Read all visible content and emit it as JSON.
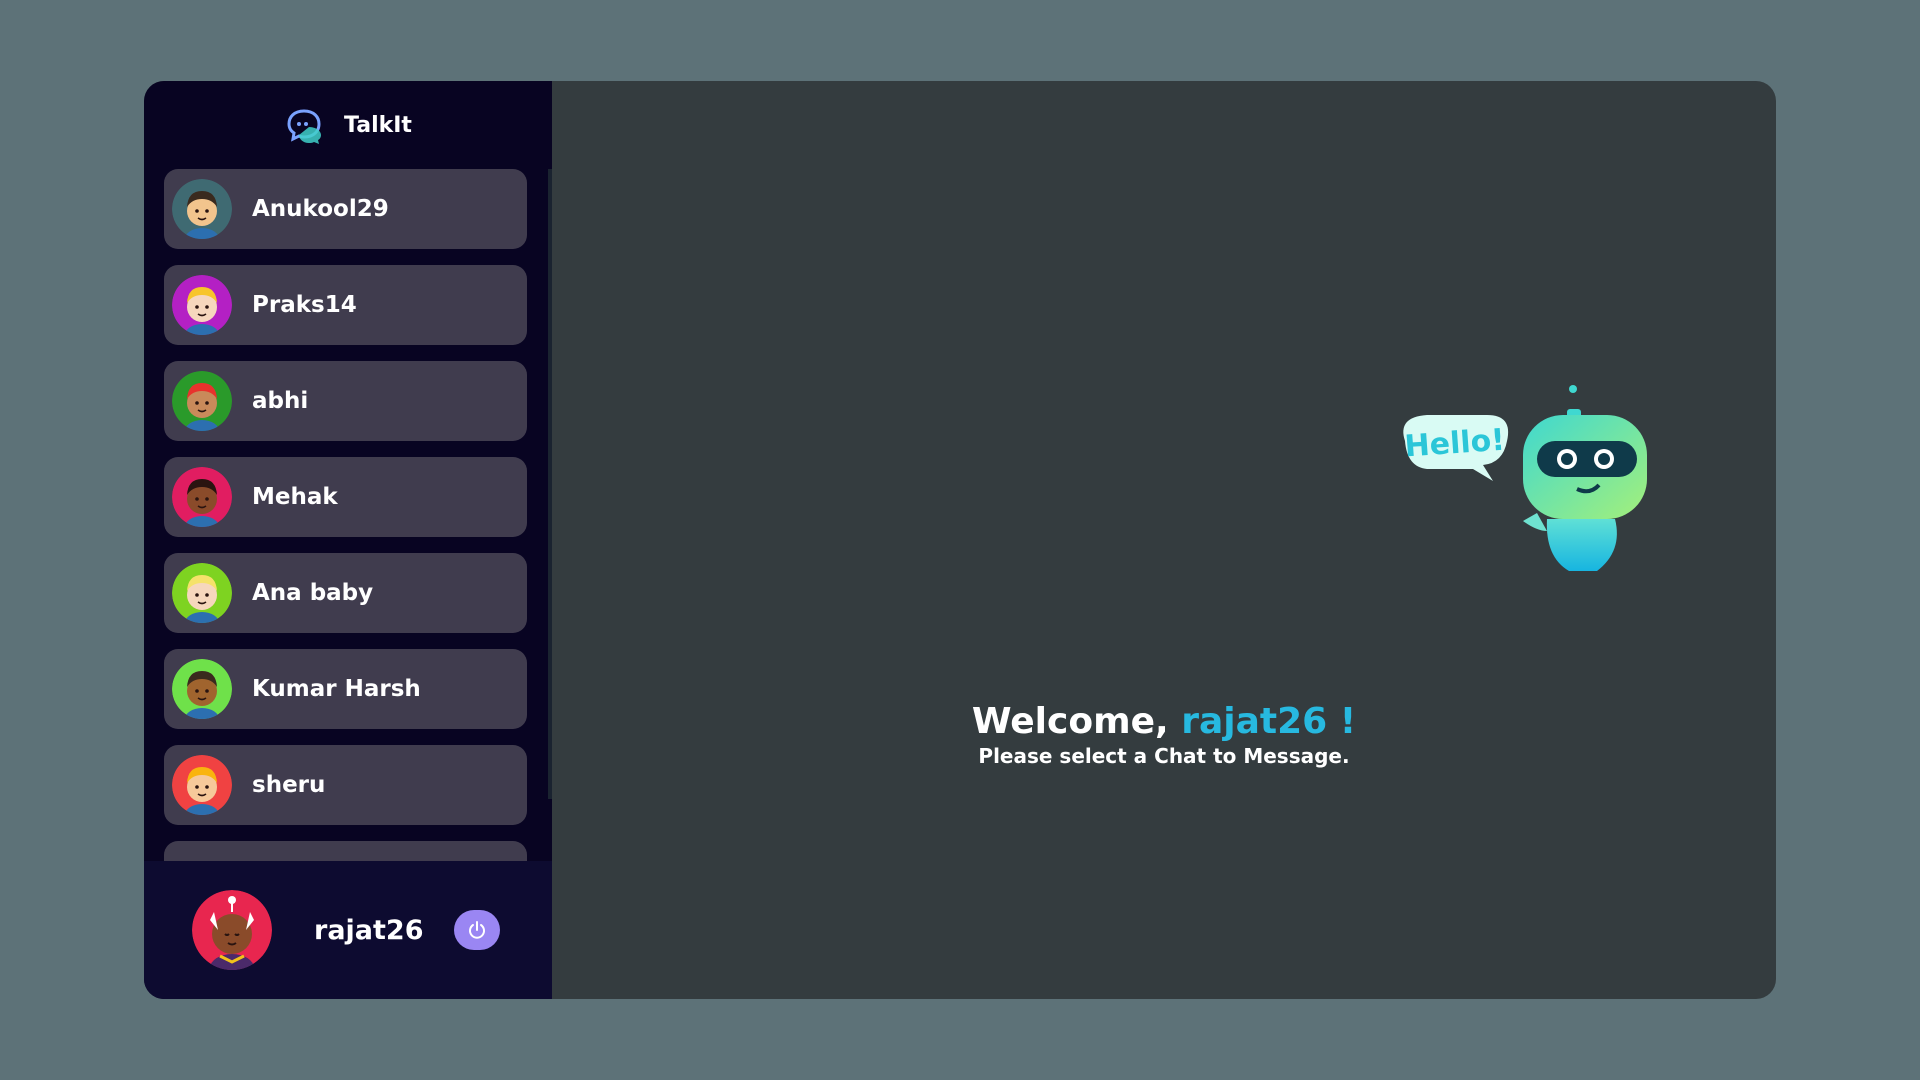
{
  "app": {
    "name": "TalkIt"
  },
  "contacts": [
    {
      "name": "Anukool29",
      "avatar_bg": "#3f6a72",
      "skin": "#f2c48d",
      "hair": "#3a2a1e"
    },
    {
      "name": "Praks14",
      "avatar_bg": "#b420c4",
      "skin": "#f6d7bd",
      "hair": "#f7c52a"
    },
    {
      "name": "abhi",
      "avatar_bg": "#2a9a2a",
      "skin": "#c98a5a",
      "hair": "#e8322c"
    },
    {
      "name": "Mehak",
      "avatar_bg": "#e11d61",
      "skin": "#8a4b2a",
      "hair": "#2a1410"
    },
    {
      "name": "Ana baby",
      "avatar_bg": "#7ed321",
      "skin": "#f6d7bd",
      "hair": "#f5e26a"
    },
    {
      "name": "Kumar Harsh",
      "avatar_bg": "#6fe14a",
      "skin": "#a0642e",
      "hair": "#3a2a1e"
    },
    {
      "name": "sheru",
      "avatar_bg": "#f04242",
      "skin": "#f6c99a",
      "hair": "#f9b40e"
    }
  ],
  "current_user": {
    "name": "rajat26",
    "avatar_bg": "#e8264f",
    "skin": "#8a4b2a"
  },
  "welcome": {
    "prefix": "Welcome, ",
    "username": "rajat26 !",
    "subtitle": "Please select a Chat to Message."
  },
  "robot": {
    "bubble_text": "Hello!"
  },
  "colors": {
    "page_bg": "#5d7278",
    "sidebar_bg": "#080422",
    "contact_bg": "#403c4e",
    "main_bg": "#343c3f",
    "accent": "#27b9e0",
    "logout_bg": "#9a86f3"
  },
  "icons": {
    "brand": "chat-bubble-logo-icon",
    "logout": "power-icon"
  }
}
